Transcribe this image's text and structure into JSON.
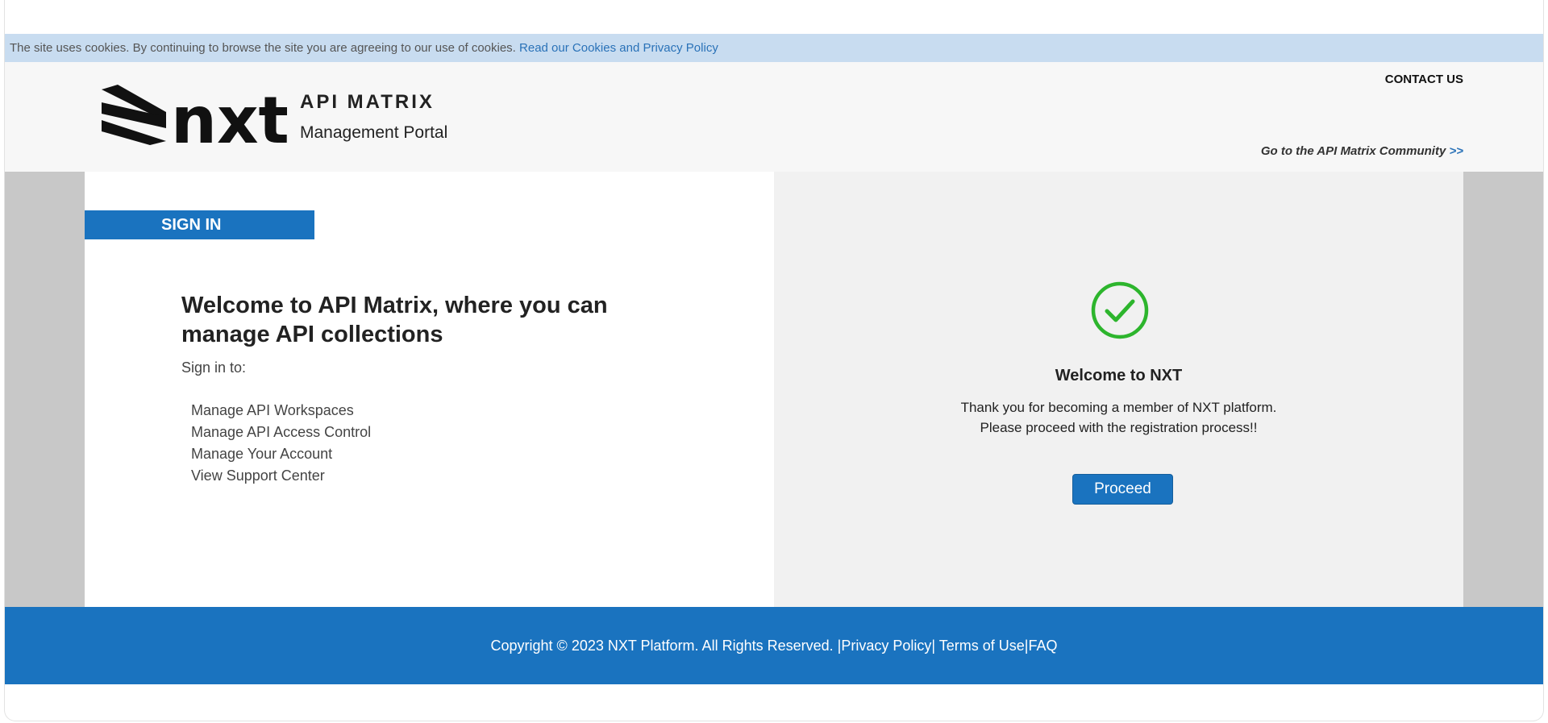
{
  "cookie_bar": {
    "text": "The site uses cookies. By continuing to browse the site you are agreeing to our use of cookies.",
    "link": "Read our Cookies and Privacy Policy"
  },
  "header": {
    "logo_text": "nxt",
    "brand_title": "API MATRIX",
    "brand_subtitle": "Management Portal",
    "contact": "CONTACT US",
    "community_text": "Go to the API Matrix Community",
    "community_arrows": ">>"
  },
  "left": {
    "tab": "SIGN IN",
    "heading": "Welcome to API Matrix, where you can manage API collections",
    "signin_to": "Sign in to:",
    "features": [
      "Manage API Workspaces",
      "Manage API Access Control",
      "Manage Your Account",
      "View Support Center"
    ]
  },
  "right": {
    "title": "Welcome to NXT",
    "line1": "Thank you for becoming a member of NXT platform.",
    "line2": "Please proceed with the registration process!!",
    "button": "Proceed"
  },
  "footer": {
    "copyright": "Copyright © 2023 NXT Platform. All Rights Reserved.",
    "sep1": "|",
    "privacy": "Privacy Policy",
    "sep2": "|",
    "terms": "Terms of Use",
    "sep3": "|",
    "faq": "FAQ"
  },
  "colors": {
    "primary": "#1a73bf",
    "cookie_bg": "#c8dcf0",
    "success": "#2db52d",
    "side_gray": "#c8c8c8"
  },
  "icons": {
    "success": "check-circle-icon",
    "logo": "nxt-logo"
  }
}
